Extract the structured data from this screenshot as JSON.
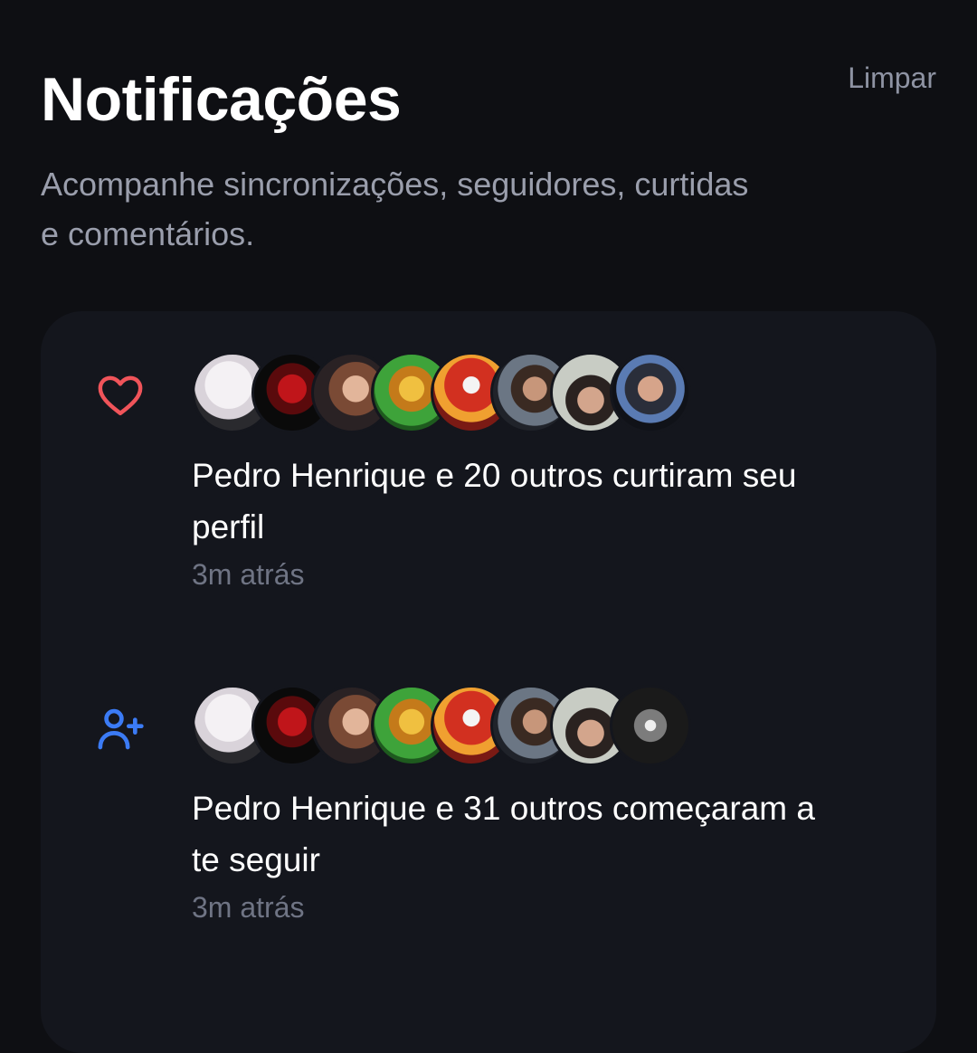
{
  "header": {
    "title": "Notificações",
    "clear_label": "Limpar",
    "subtitle": "Acompanhe sincronizações, seguidores, curtidas e comentários."
  },
  "notifications": [
    {
      "type": "like",
      "icon": "heart-icon",
      "icon_color": "#f0545a",
      "text": "Pedro Henrique e 20 outros curtiram seu perfil",
      "time": "3m atrás",
      "avatar_count": 8
    },
    {
      "type": "follow",
      "icon": "user-plus-icon",
      "icon_color": "#3b7bf5",
      "text": "Pedro Henrique e 31 outros começaram a te seguir",
      "time": "3m atrás",
      "avatar_count": 8
    }
  ],
  "colors": {
    "background": "#0e0f13",
    "card": "#14161d",
    "muted_text": "#9a9eac",
    "time_text": "#6f7484"
  }
}
